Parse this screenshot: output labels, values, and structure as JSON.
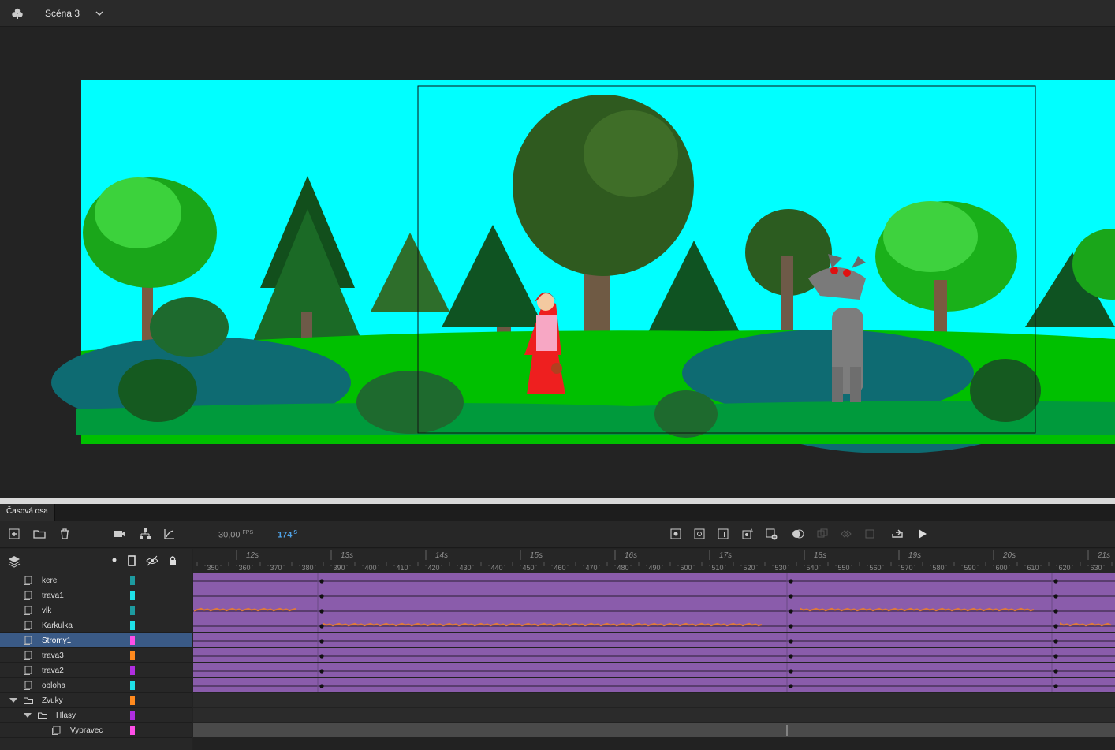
{
  "header": {
    "scene_name": "Scéna 3",
    "icons": [
      "scene-icon",
      "chevron-down-icon"
    ]
  },
  "timeline": {
    "tab_label": "Časová osa",
    "fps_value": "30,00",
    "fps_unit": "FPS",
    "current_frame": "174",
    "current_frame_unit": "S",
    "ruler": {
      "seconds": [
        "12s",
        "13s",
        "14s",
        "15s",
        "16s",
        "17s",
        "18s",
        "19s",
        "20s",
        "21s"
      ],
      "frames": [
        "350",
        "360",
        "370",
        "380",
        "390",
        "400",
        "410",
        "420",
        "430",
        "440",
        "450",
        "460",
        "470",
        "480",
        "490",
        "500",
        "510",
        "520",
        "530",
        "540",
        "550",
        "560",
        "570",
        "580",
        "590",
        "600",
        "610",
        "620",
        "630"
      ]
    },
    "layers": [
      {
        "name": "kere",
        "color": "#1d9ba0",
        "type": "layer"
      },
      {
        "name": "trava1",
        "color": "#1fe0e8",
        "type": "layer"
      },
      {
        "name": "vlk",
        "color": "#1d9ba0",
        "type": "layer"
      },
      {
        "name": "Karkulka",
        "color": "#1fe0e8",
        "type": "layer"
      },
      {
        "name": "Stromy1",
        "color": "#ff4fe8",
        "type": "layer",
        "selected": true
      },
      {
        "name": "trava3",
        "color": "#ff8a1e",
        "type": "layer"
      },
      {
        "name": "trava2",
        "color": "#b02ee0",
        "type": "layer"
      },
      {
        "name": "obloha",
        "color": "#1fe0e8",
        "type": "layer"
      },
      {
        "name": "Zvuky",
        "color": "#ff8a1e",
        "type": "folder"
      },
      {
        "name": "Hlasy",
        "color": "#b02ee0",
        "type": "folder"
      },
      {
        "name": "Vypravec",
        "color": "#ff4fe8",
        "type": "layer"
      }
    ],
    "toolbar_icons": [
      "new-layer-icon",
      "new-folder-icon",
      "delete-icon",
      "camera-icon",
      "parenting-icon",
      "graph-icon",
      "keyframe-icon",
      "blank-keyframe-icon",
      "frame-icon",
      "auto-keyframe-icon",
      "remove-frame-icon",
      "onion-skin-icon",
      "loop-icon",
      "play-icon"
    ],
    "header_icons": [
      "layers-icon",
      "highlight-icon",
      "outline-icon",
      "visibility-icon",
      "lock-icon"
    ]
  }
}
